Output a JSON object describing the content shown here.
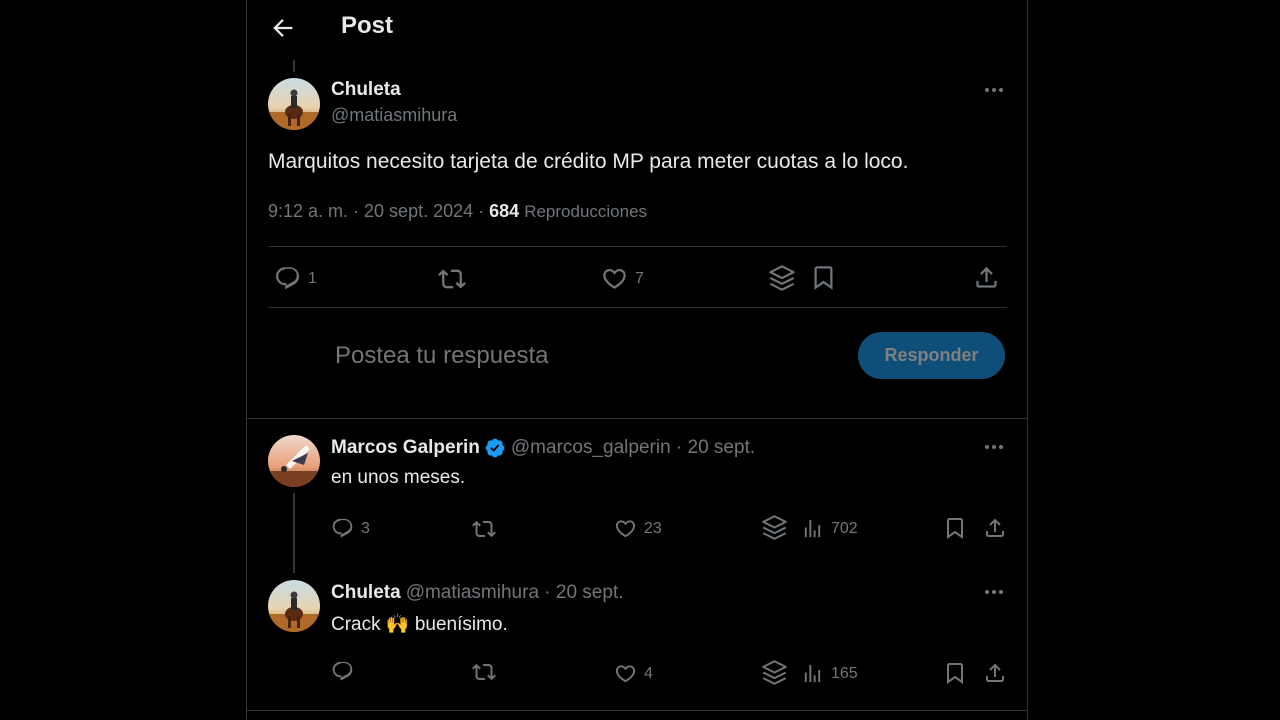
{
  "header": {
    "title": "Post"
  },
  "main_post": {
    "name": "Chuleta",
    "handle": "@matiasmihura",
    "text": "Marquitos necesito tarjeta de crédito MP para meter cuotas a lo loco.",
    "time": "9:12 a. m. · 20 sept. 2024 · ",
    "views": "684",
    "views_label": "Reproducciones",
    "replies": "1",
    "likes": "7"
  },
  "reply_box": {
    "placeholder": "Postea tu respuesta",
    "button": "Responder"
  },
  "replies": [
    {
      "name": "Marcos Galperin",
      "verified": true,
      "handle": "@marcos_galperin · 20 sept.",
      "text": "en unos meses.",
      "replies": "3",
      "likes": "23",
      "views": "702"
    },
    {
      "name": "Chuleta",
      "verified": false,
      "handle": "@matiasmihura · 20 sept.",
      "text": "Crack 🙌 buenísimo.",
      "replies": "",
      "likes": "4",
      "views": "165"
    }
  ],
  "colors": {
    "background": "#000000",
    "text": "#e7e9ea",
    "muted": "#71767b",
    "border": "#2f3336",
    "accent_button": "#0f4e78",
    "verified": "#1d9bf0"
  },
  "icons": [
    "back-arrow-icon",
    "more-icon",
    "reply-icon",
    "retweet-icon",
    "like-icon",
    "grok-icon",
    "bookmark-icon",
    "share-icon",
    "views-icon",
    "verified-icon"
  ]
}
